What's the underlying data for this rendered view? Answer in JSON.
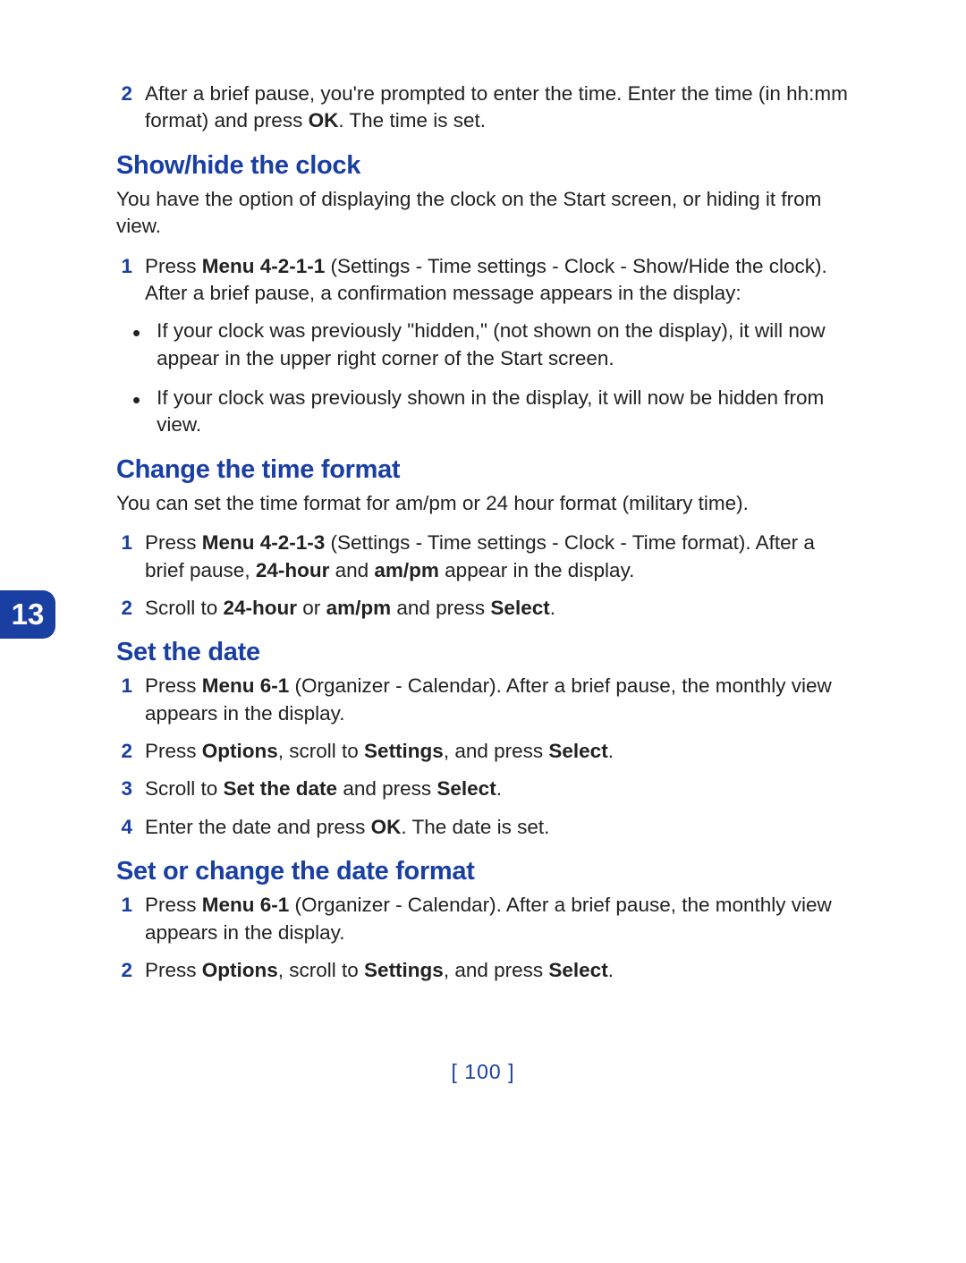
{
  "chapter_number": "13",
  "page_number": "[ 100 ]",
  "intro_step": {
    "num": "2",
    "text_before_ok": "After a brief pause, you're prompted to enter the time. Enter the time (in hh:mm format) and press ",
    "ok": "OK",
    "text_after_ok": ". The time is set."
  },
  "sec1": {
    "heading": "Show/hide the clock",
    "intro": "You have the option of displaying the clock on the Start screen, or hiding it from view.",
    "step1": {
      "num": "1",
      "pre": "Press ",
      "menu": "Menu 4-2-1-1",
      "post": " (Settings - Time settings - Clock - Show/Hide the clock). After a brief pause, a confirmation message appears in the display:"
    },
    "bullet1": "If your clock was previously \"hidden,\" (not shown on the display), it will now appear in the upper right corner of the Start screen.",
    "bullet2": "If your clock was previously shown in the display, it will now be hidden from view."
  },
  "sec2": {
    "heading": "Change the time format",
    "intro": "You can set the time format for am/pm or 24 hour format (military time).",
    "step1": {
      "num": "1",
      "pre": "Press ",
      "menu": "Menu 4-2-1-3",
      "mid1": " (Settings - Time settings - Clock - Time format). After a brief pause, ",
      "b1": "24-hour",
      "mid2": " and ",
      "b2": "am/pm",
      "post": " appear in the display."
    },
    "step2": {
      "num": "2",
      "pre": "Scroll to ",
      "b1": "24-hour",
      "mid": " or ",
      "b2": "am/pm",
      "mid2": " and press ",
      "b3": "Select",
      "post": "."
    }
  },
  "sec3": {
    "heading": "Set the date",
    "step1": {
      "num": "1",
      "pre": "Press ",
      "menu": "Menu 6-1",
      "post": " (Organizer - Calendar). After a brief pause, the monthly view appears in the display."
    },
    "step2": {
      "num": "2",
      "pre": "Press ",
      "b1": "Options",
      "mid1": ", scroll to ",
      "b2": "Settings",
      "mid2": ", and press ",
      "b3": "Select",
      "post": "."
    },
    "step3": {
      "num": "3",
      "pre": "Scroll to ",
      "b1": "Set the date",
      "mid": " and press ",
      "b2": "Select",
      "post": "."
    },
    "step4": {
      "num": "4",
      "pre": "Enter the date and press ",
      "b1": "OK",
      "post": ". The date is set."
    }
  },
  "sec4": {
    "heading": "Set or change the date format",
    "step1": {
      "num": "1",
      "pre": "Press ",
      "menu": "Menu 6-1",
      "post": " (Organizer - Calendar). After a brief pause, the monthly view appears in the display."
    },
    "step2": {
      "num": "2",
      "pre": "Press ",
      "b1": "Options",
      "mid1": ", scroll to ",
      "b2": "Settings",
      "mid2": ", and press ",
      "b3": "Select",
      "post": "."
    }
  }
}
